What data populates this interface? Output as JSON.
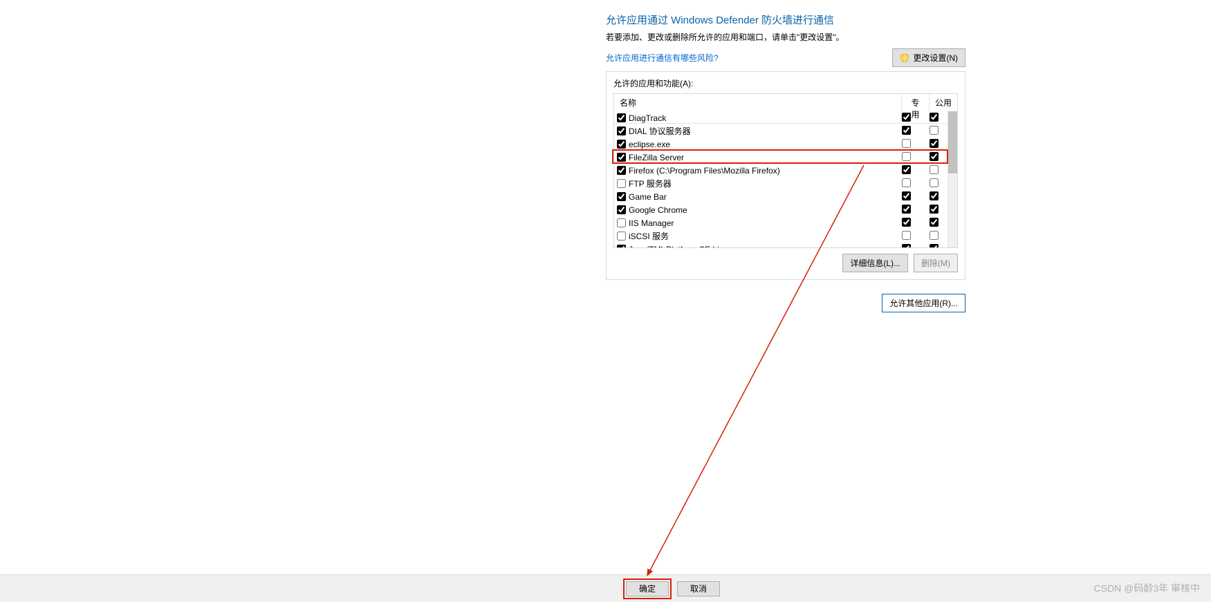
{
  "header": {
    "title": "允许应用通过 Windows Defender 防火墙进行通信",
    "subtitle": "若要添加、更改或删除所允许的应用和端口，请单击\"更改设置\"。",
    "risk_link": "允许应用进行通信有哪些风险?",
    "change_settings_btn": "更改设置(N)"
  },
  "listbox": {
    "group_label": "允许的应用和功能(A):",
    "columns": {
      "name": "名称",
      "private": "专用",
      "public": "公用"
    },
    "rows": [
      {
        "enabled": true,
        "name": "DiagTrack",
        "private": true,
        "public": true
      },
      {
        "enabled": true,
        "name": "DIAL 协议服务器",
        "private": true,
        "public": false
      },
      {
        "enabled": true,
        "name": "eclipse.exe",
        "private": false,
        "public": true
      },
      {
        "enabled": true,
        "name": "FileZilla Server",
        "private": false,
        "public": true
      },
      {
        "enabled": true,
        "name": "Firefox (C:\\Program Files\\Mozilla Firefox)",
        "private": true,
        "public": false
      },
      {
        "enabled": false,
        "name": "FTP 服务器",
        "private": false,
        "public": false
      },
      {
        "enabled": true,
        "name": "Game Bar",
        "private": true,
        "public": true
      },
      {
        "enabled": true,
        "name": "Google Chrome",
        "private": true,
        "public": true
      },
      {
        "enabled": false,
        "name": "IIS Manager",
        "private": true,
        "public": true
      },
      {
        "enabled": false,
        "name": "iSCSI 服务",
        "private": false,
        "public": false
      },
      {
        "enabled": true,
        "name": "Java(TM) Platform SE binary",
        "private": true,
        "public": true
      }
    ],
    "details_btn": "详细信息(L)...",
    "remove_btn": "删除(M)",
    "allow_other_btn": "允许其他应用(R)..."
  },
  "footer": {
    "ok": "确定",
    "cancel": "取消"
  },
  "watermark": "CSDN @码龄3年  审核中",
  "annotations": {
    "highlighted_row_index": 3,
    "arrow_target": "footer.ok"
  }
}
